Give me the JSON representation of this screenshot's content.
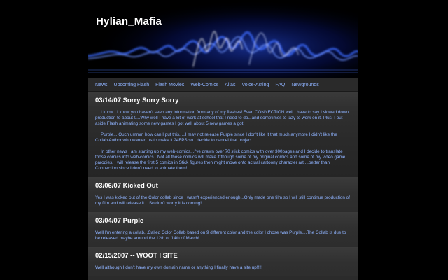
{
  "site": {
    "title": "Hylian_Mafia"
  },
  "nav": [
    "News",
    "Upcoming Flash",
    "Flash Movies",
    "Web-Comics",
    "Alias",
    "Voice-Acting",
    "FAQ",
    "Newgrounds"
  ],
  "posts": [
    {
      "title": "03/14/07 Sorry Sorry Sorry",
      "paragraphs": [
        "I know...I know you haven't seen any information from any of my flashes! Even CONNECTION well I have to say I slowed down production to about 0...Why well I have a lot of work at school that I need to do...and sometimes to lazy to work on it. Plus, I put aside Flash animating some new games I got well about 5 new games a got!",
        "Purple....Ouch ummm how can I put this.....I may not release Purple since I  don't like it that much anymore I didn't like the Collab Author who wanted us to make it 24FPS so I decide to cancel that project.",
        "In other news I am starting up my web-comics...I've drawn over 70 stick comics with over 300pages and I decide to translate those comics into web-comics...Not all those comics will make it though some of my original comics and some of my video game parodies. I will release the first 5 comics in Stick figures then might move onto actual cartoony character art....better than Connection since I don't need to animate them!"
      ]
    },
    {
      "title": "03/06/07 Kicked Out",
      "paragraphs": [
        "Yes I was kicked out of the Color collab since I wasn't experienced enough...Only made one film so I will still continue production of my film and will release it....So don't worry it is coming!"
      ]
    },
    {
      "title": "03/04/07 Purple",
      "paragraphs": [
        "Well I'm entering a collab...Called Color Collab based on 9 different color and the color I chose was Purple....The Collab is due to be released maybe around the 12th or 14th of March!"
      ]
    },
    {
      "title": "02/15/2007 -- WOOT I SITE",
      "paragraphs": [
        "Well although I don't have my own domain name or anything I finally have a site up!!!!"
      ]
    }
  ]
}
